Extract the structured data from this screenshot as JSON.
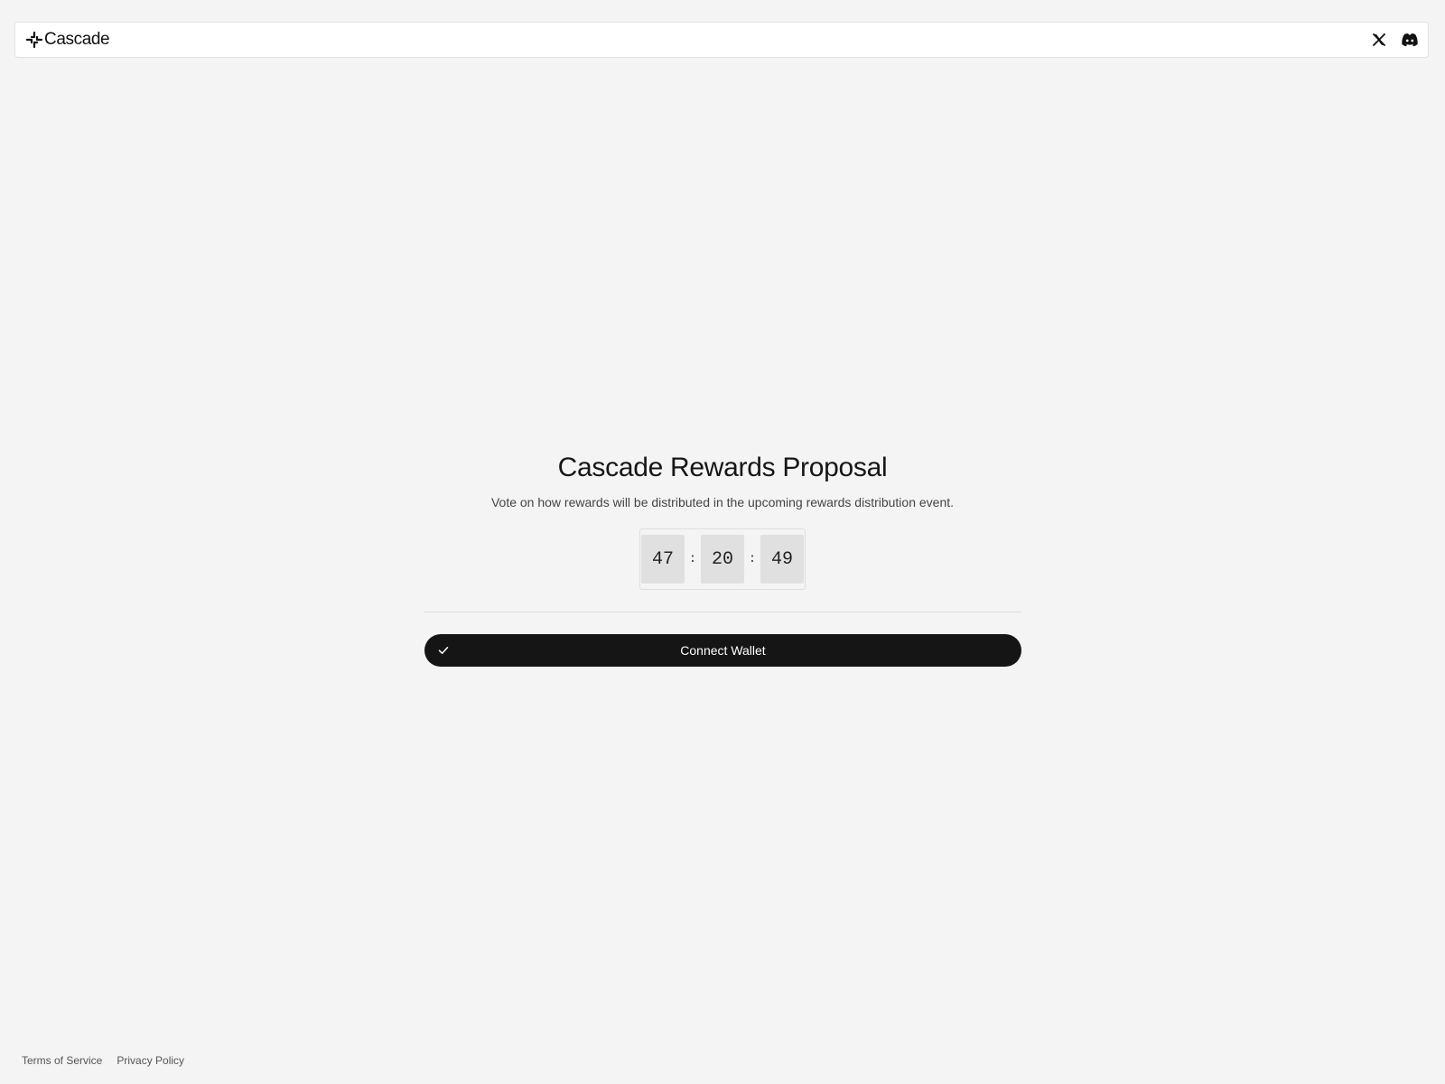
{
  "header": {
    "brand_name": "Cascade",
    "brand_icon": "cascade-logo-icon",
    "social": [
      {
        "icon": "x-twitter-icon"
      },
      {
        "icon": "discord-icon"
      }
    ]
  },
  "main": {
    "title": "Cascade Rewards Proposal",
    "subtitle": "Vote on how rewards will be distributed in the upcoming rewards distribution event.",
    "countdown": {
      "hours": "47",
      "minutes": "20",
      "seconds": "49",
      "separator": ":"
    },
    "connect_button": {
      "label": "Connect Wallet",
      "icon": "check-icon"
    }
  },
  "footer": {
    "links": [
      "Terms of Service",
      "Privacy Policy"
    ]
  },
  "colors": {
    "background": "#f4f4f4",
    "button": "#151515",
    "button_text": "#ffffff",
    "timer_box": "#e0e0e0"
  }
}
